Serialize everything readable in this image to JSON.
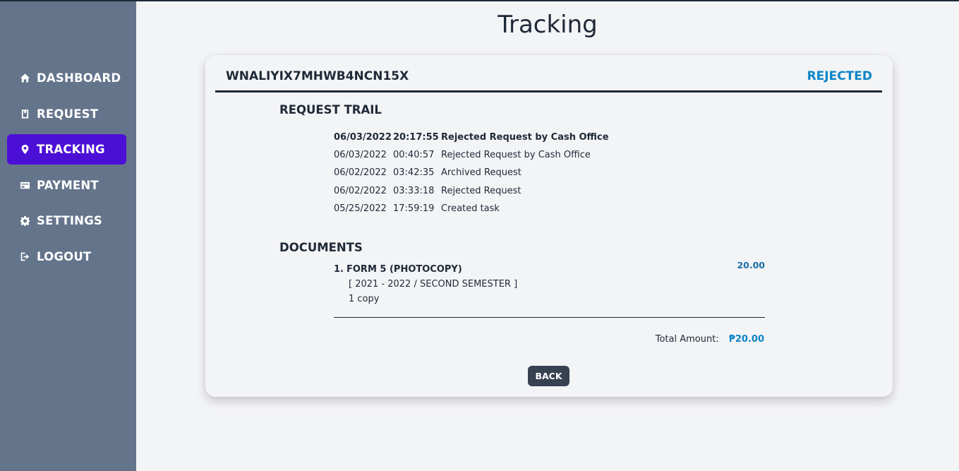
{
  "page_title": "Tracking",
  "sidebar": {
    "items": [
      {
        "label": "DASHBOARD",
        "icon": "home-icon",
        "active": false
      },
      {
        "label": "REQUEST",
        "icon": "request-icon",
        "active": false
      },
      {
        "label": "TRACKING",
        "icon": "location-pin-icon",
        "active": true
      },
      {
        "label": "PAYMENT",
        "icon": "credit-card-icon",
        "active": false
      },
      {
        "label": "SETTINGS",
        "icon": "gear-icon",
        "active": false
      },
      {
        "label": "LOGOUT",
        "icon": "logout-icon",
        "active": false
      }
    ]
  },
  "request": {
    "code": "WNALIYIX7MHWB4NCN15X",
    "status": "REJECTED",
    "status_color": "#0a84c6"
  },
  "trail": {
    "heading": "REQUEST TRAIL",
    "entries": [
      {
        "date": "06/03/2022",
        "time": "20:17:55",
        "action": "Rejected Request by Cash Office"
      },
      {
        "date": "06/03/2022",
        "time": "00:40:57",
        "action": "Rejected Request by Cash Office"
      },
      {
        "date": "06/02/2022",
        "time": "03:42:35",
        "action": "Archived Request"
      },
      {
        "date": "06/02/2022",
        "time": "03:33:18",
        "action": "Rejected Request"
      },
      {
        "date": "05/25/2022",
        "time": "17:59:19",
        "action": "Created task"
      }
    ]
  },
  "documents": {
    "heading": "DOCUMENTS",
    "items": [
      {
        "index": "1.",
        "name": "FORM 5 (PHOTOCOPY)",
        "term": "[ 2021 - 2022 / SECOND SEMESTER ]",
        "copies": "1 copy",
        "amount": "20.00"
      }
    ],
    "total_label": "Total Amount:",
    "total_value": "₱20.00"
  },
  "back_label": "BACK",
  "colors": {
    "sidebar": "#64748b",
    "active_nav": "#4c0fd6",
    "accent": "#0a84c6"
  }
}
